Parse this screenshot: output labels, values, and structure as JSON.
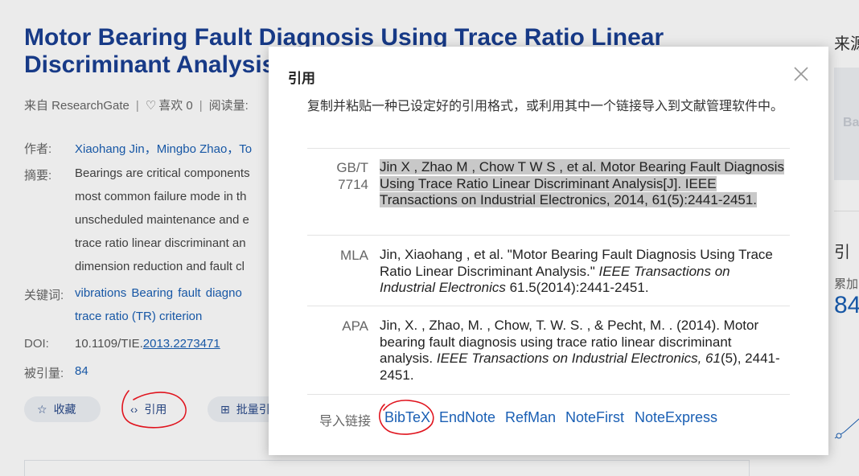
{
  "paper": {
    "title": "Motor Bearing Fault Diagnosis Using Trace Ratio Linear Discriminant Analysis",
    "source": "来自 ResearchGate",
    "likes_label": "喜欢 0",
    "reads_label": "阅读量:",
    "authors_label": "作者:",
    "authors": "Xiaohang Jin，Mingbo Zhao，To",
    "abstract_label": "摘要:",
    "abstract_lines": [
      "Bearings are critical components",
      "most common failure mode in th",
      "unscheduled maintenance and e",
      "trace ratio linear discriminant an",
      "dimension reduction and fault cl"
    ],
    "keywords_label": "关键词:",
    "keywords_line1": "vibrations  Bearing  fault diagno",
    "keywords_line2": "trace ratio (TR) criterion",
    "doi_label": "DOI:",
    "doi_prefix": "10.1109/TIE.",
    "doi_link": "2013.2273471",
    "cited_label": "被引量:",
    "cited_value": "84",
    "btn_collect": "收藏",
    "btn_cite": "引用",
    "btn_batch": "批量引"
  },
  "right_column": {
    "source_heading": "来源",
    "box_text": "Ba",
    "cite_heading": "引",
    "cumulative_label": "累加",
    "cumulative_value": "84"
  },
  "modal": {
    "title": "引用",
    "description": "复制并粘贴一种已设定好的引用格式，或利用其中一个链接导入到文献管理软件中。",
    "citations": [
      {
        "label_line1": "GB/T",
        "label_line2": "7714",
        "text": "Jin X , Zhao M , Chow T W S , et al. Motor Bearing Fault Diagnosis Using Trace Ratio Linear Discriminant Analysis[J]. IEEE Transactions on Industrial Electronics, 2014, 61(5):2441-2451."
      },
      {
        "label_line1": "MLA",
        "text_pre": "Jin, Xiaohang , et al. \"Motor Bearing Fault Diagnosis Using Trace Ratio Linear Discriminant Analysis.\" ",
        "text_italic": "IEEE Transactions on Industrial Electronics",
        "text_post": " 61.5(2014):2441-2451."
      },
      {
        "label_line1": "APA",
        "text_pre": "Jin, X. , Zhao, M. , Chow, T. W. S. , & Pecht, M. . (2014). Motor bearing fault diagnosis using trace ratio linear discriminant analysis. ",
        "text_italic": "IEEE Transactions on Industrial Electronics, 61",
        "text_post": "(5), 2441-2451."
      }
    ],
    "import_label": "导入链接",
    "import_links": [
      "BibTeX",
      "EndNote",
      "RefMan",
      "NoteFirst",
      "NoteExpress"
    ]
  },
  "colors": {
    "title_blue": "#1a3f93",
    "link_blue": "#1a5fb4",
    "selection_gray": "#c8c8c8",
    "annotation_red": "#e0141e"
  },
  "icons": {
    "heart": "heart-icon",
    "star": "star-icon",
    "code": "code-icon",
    "folder_add": "folder-add-icon",
    "close": "close-icon"
  }
}
